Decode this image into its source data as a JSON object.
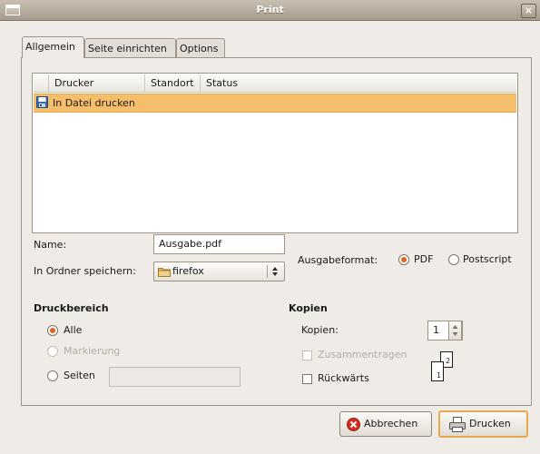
{
  "window": {
    "title": "Print",
    "close_glyph": "×"
  },
  "tabs": [
    {
      "label": "Allgemein",
      "active": true
    },
    {
      "label": "Seite einrichten",
      "active": false
    },
    {
      "label": "Options",
      "active": false
    }
  ],
  "printer_list": {
    "columns": [
      "Drucker",
      "Standort",
      "Status"
    ],
    "rows": [
      {
        "name": "In Datei drucken",
        "icon": "save-file-icon",
        "selected": true
      }
    ]
  },
  "file": {
    "name_label": "Name:",
    "name_value": "Ausgabe.pdf",
    "folder_label": "In Ordner speichern:",
    "folder_value": "firefox",
    "format_label": "Ausgabeformat:",
    "format_options": [
      {
        "label": "PDF",
        "selected": true
      },
      {
        "label": "Postscript",
        "selected": false
      }
    ]
  },
  "range": {
    "heading": "Druckbereich",
    "options": [
      {
        "label": "Alle",
        "selected": true,
        "enabled": true
      },
      {
        "label": "Markierung",
        "selected": false,
        "enabled": false
      },
      {
        "label": "Seiten",
        "selected": false,
        "enabled": true
      }
    ],
    "pages_value": ""
  },
  "copies": {
    "heading": "Kopien",
    "label": "Kopien:",
    "value": "1",
    "collate_label": "Zusammentragen",
    "collate_enabled": false,
    "reverse_label": "Rückwärts",
    "preview_pages": [
      "1",
      "2"
    ]
  },
  "buttons": {
    "cancel": "Abbrechen",
    "print": "Drucken"
  },
  "colors": {
    "selection": "#f5be6a",
    "radio_on": "#e5621c",
    "titlebar": "#b7ad9f"
  }
}
